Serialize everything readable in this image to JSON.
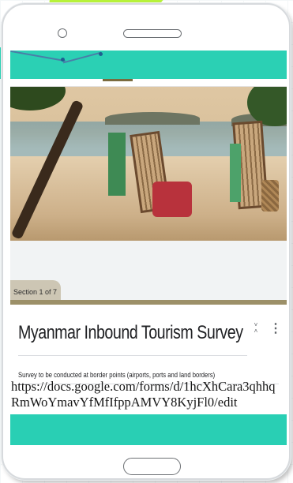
{
  "form": {
    "section_label": "Section 1 of 7",
    "title": "Myanmar Inbound Tourism Survey",
    "description": "Survey to be conducted at border points (airports, ports and land borders)",
    "hero_image": "beach-chairs-photo"
  },
  "caption": {
    "url": "https://docs.google.com/forms/d/1hcXhCara3qhhqRmWoYmavYfMfIfppAMVY8KyjFl0/edit"
  },
  "icons": {
    "collapse": "collapse-icon",
    "more": "more-vertical-icon"
  },
  "colors": {
    "accent_teal": "#29cfb4",
    "section_accent": "#9c9068",
    "lime_decoration": "#b7f23a"
  }
}
